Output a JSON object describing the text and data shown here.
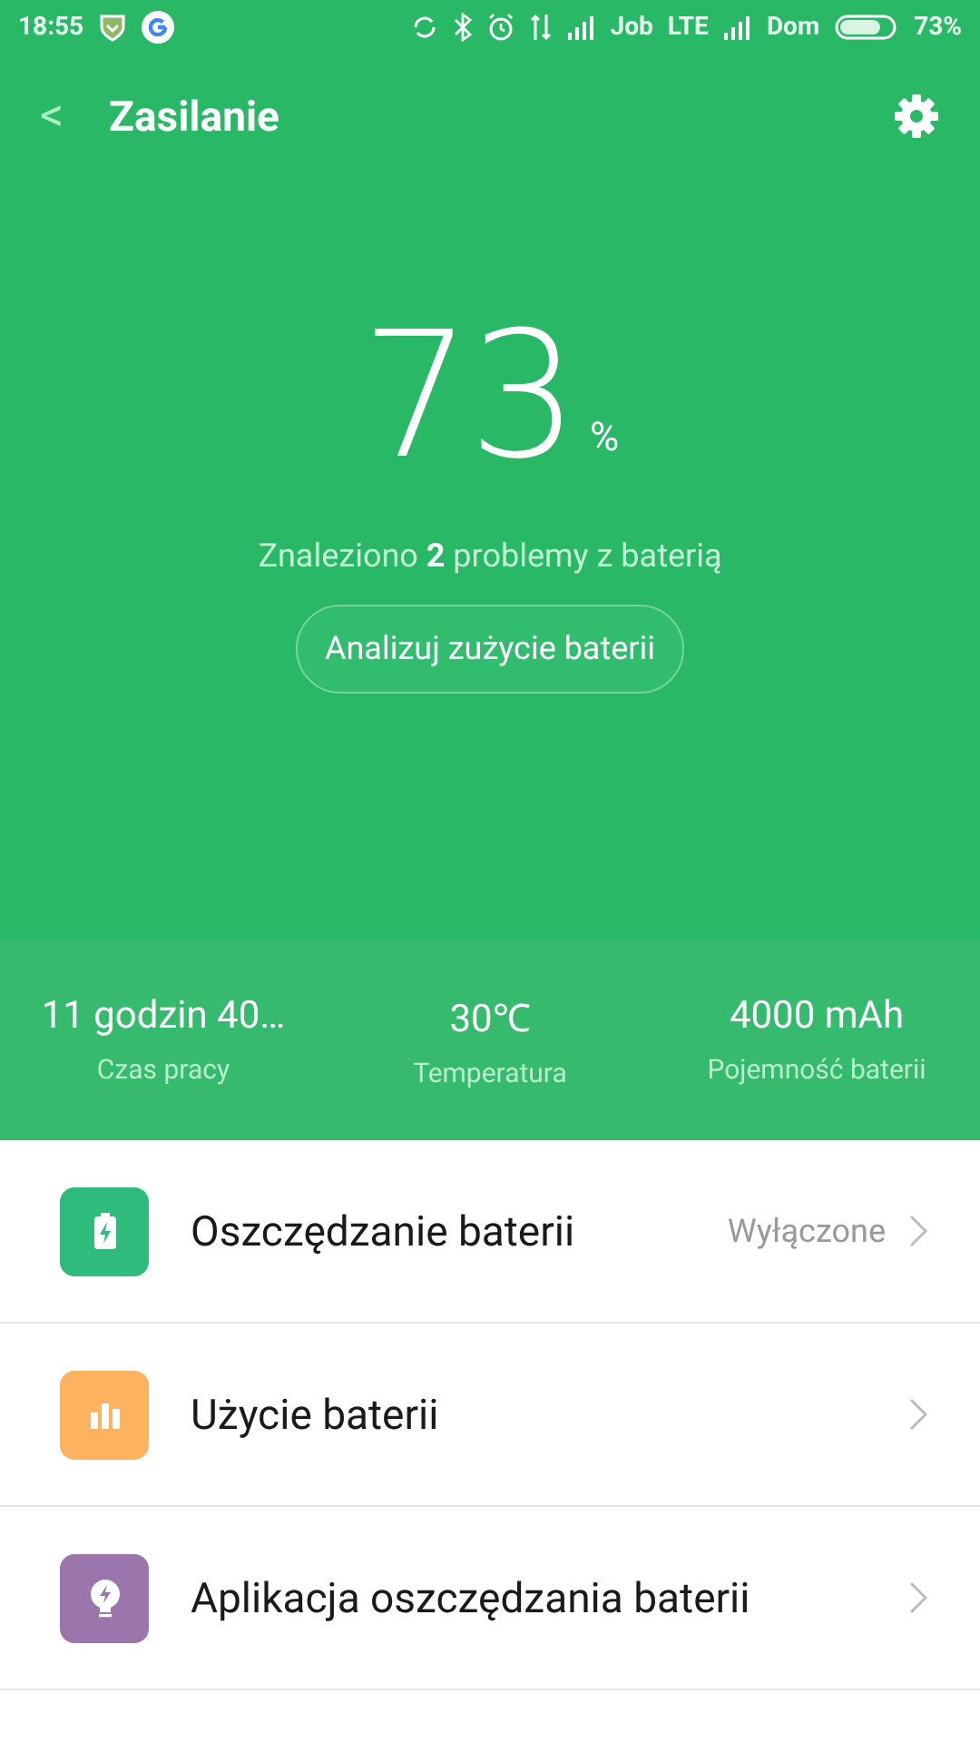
{
  "status_bar": {
    "time": "18:55",
    "carrier_1": "Job",
    "network_type": "LTE",
    "carrier_2": "Dom",
    "battery_percent": "73%"
  },
  "header": {
    "back": "<",
    "title": "Zasilanie"
  },
  "battery": {
    "percent": "73",
    "unit": "%",
    "problems": "Znaleziono **2** problemy z baterią",
    "action": "Analizuj zużycie baterii"
  },
  "stats": [
    {
      "value": "11 godzin 40…",
      "label": "Czas pracy"
    },
    {
      "value": "30℃",
      "label": "Temperatura"
    },
    {
      "value": "4000 mAh",
      "label": "Pojemność baterii"
    }
  ],
  "menu": [
    {
      "kind": "battery",
      "color": "#2fbb7b",
      "title": "Oszczędzanie baterii",
      "value": "Wyłączone"
    },
    {
      "kind": "chart",
      "color": "#fdb25f",
      "title": "Użycie baterii"
    },
    {
      "kind": "bulb",
      "color": "#9a76ad",
      "title": "Aplikacja oszczędzania baterii"
    }
  ]
}
